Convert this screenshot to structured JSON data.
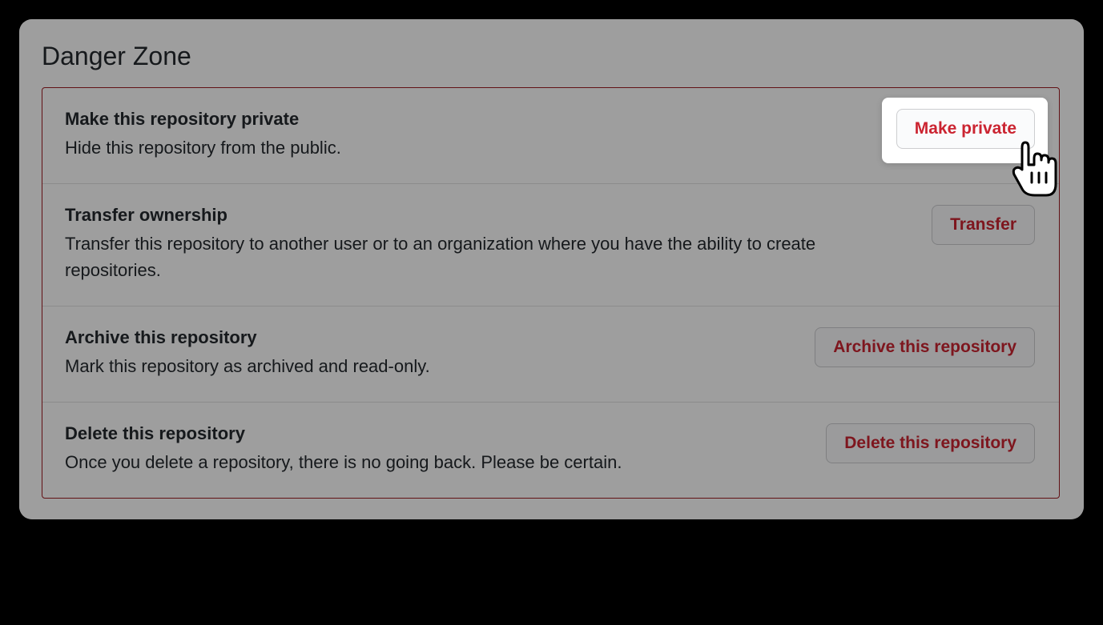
{
  "dangerZone": {
    "title": "Danger Zone",
    "rows": [
      {
        "title": "Make this repository private",
        "description": "Hide this repository from the public.",
        "buttonLabel": "Make private",
        "highlighted": true
      },
      {
        "title": "Transfer ownership",
        "description": "Transfer this repository to another user or to an organization where you have the ability to create repositories.",
        "buttonLabel": "Transfer",
        "highlighted": false
      },
      {
        "title": "Archive this repository",
        "description": "Mark this repository as archived and read-only.",
        "buttonLabel": "Archive this repository",
        "highlighted": false
      },
      {
        "title": "Delete this repository",
        "description": "Once you delete a repository, there is no going back. Please be certain.",
        "buttonLabel": "Delete this repository",
        "highlighted": false
      }
    ]
  },
  "colors": {
    "dangerBorder": "#9e1c23",
    "dangerText": "#cb2431"
  }
}
